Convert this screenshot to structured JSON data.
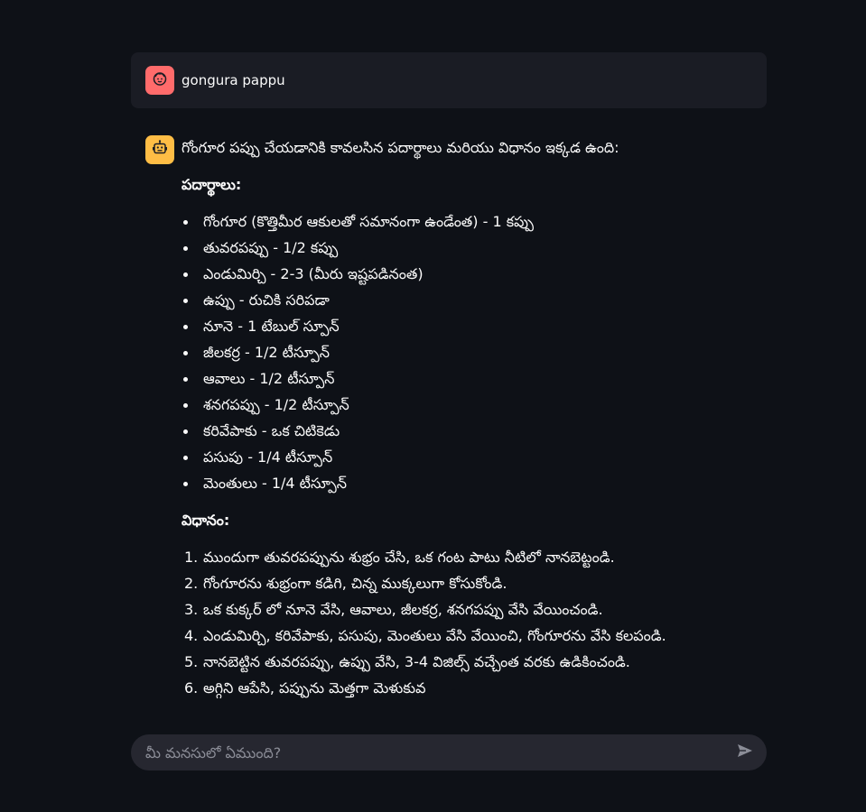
{
  "user_message": {
    "text": "gongura pappu",
    "avatar_icon": "face-icon",
    "avatar_color": "#ff6b6b"
  },
  "assistant_message": {
    "avatar_icon": "robot-icon",
    "avatar_color": "#ffbd45",
    "intro": "గోంగూర పప్పు చేయడానికి కావలసిన పదార్థాలు మరియు విధానం ఇక్కడ ఉంది:",
    "ingredients_title": "పదార్థాలు:",
    "ingredients": [
      "గోంగూర (కొత్తిమీర ఆకులతో సమానంగా ఉండేంత) - 1 కప్పు",
      "తువరపప్పు - 1/2 కప్పు",
      "ఎండుమిర్చి - 2-3 (మీరు ఇష్టపడినంత)",
      "ఉప్పు - రుచికి సరిపడా",
      "నూనె - 1 టేబుల్ స్పూన్",
      "జీలకర్ర - 1/2 టీస్పూన్",
      "ఆవాలు - 1/2 టీస్పూన్",
      "శనగపప్పు - 1/2 టీస్పూన్",
      "కరివేపాకు - ఒక చిటికెడు",
      "పసుపు - 1/4 టీస్పూన్",
      "మెంతులు - 1/4 టీస్పూన్"
    ],
    "method_title": "విధానం:",
    "steps": [
      {
        "num": "1.",
        "text": "ముందుగా తువరపప్పును శుభ్రం చేసి, ఒక గంట పాటు నీటిలో నానబెట్టండి."
      },
      {
        "num": "2.",
        "text": "గోంగూరను శుభ్రంగా కడిగి, చిన్న ముక్కలుగా కోసుకోండి."
      },
      {
        "num": "3.",
        "text": "ఒక కుక్కర్ లో నూనె వేసి, ఆవాలు, జీలకర్ర, శనగపప్పు వేసి వేయించండి."
      },
      {
        "num": "4.",
        "text": "ఎండుమిర్చి, కరివేపాకు, పసుపు, మెంతులు వేసి వేయించి, గోంగూరను వేసి కలపండి."
      },
      {
        "num": "5.",
        "text": "నానబెట్టిన తువరపప్పు, ఉప్పు వేసి, 3-4 విజిల్స్ వచ్చేంత వరకు ఉడికించండి."
      },
      {
        "num": "6.",
        "text": "అగ్గిని ఆపేసి, పప్పును మెత్తగా మెళుకువ"
      }
    ]
  },
  "chat_input": {
    "placeholder": "మీ మనసులో ఏముంది?",
    "send_icon": "send-icon"
  }
}
